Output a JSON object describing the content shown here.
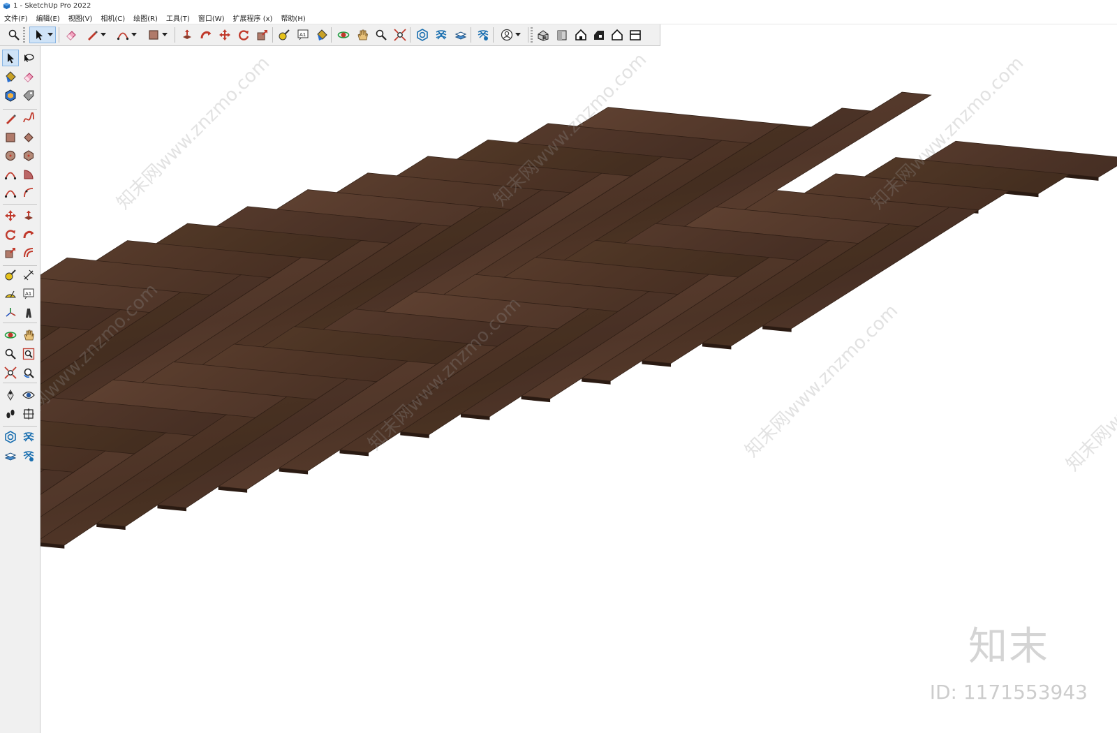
{
  "window": {
    "title": "1 - SketchUp Pro 2022"
  },
  "menu": [
    {
      "label": "文件(F)"
    },
    {
      "label": "编辑(E)"
    },
    {
      "label": "视图(V)"
    },
    {
      "label": "相机(C)"
    },
    {
      "label": "绘图(R)"
    },
    {
      "label": "工具(T)"
    },
    {
      "label": "窗口(W)"
    },
    {
      "label": "扩展程序 (x)"
    },
    {
      "label": "帮助(H)"
    }
  ],
  "top_toolbar": [
    {
      "icon": "zoom-icon",
      "active": false
    },
    {
      "icon": "select-arrow-icon",
      "active": true,
      "dropdown": true
    },
    {
      "icon": "eraser-icon"
    },
    {
      "icon": "pencil-line-icon",
      "dropdown": true
    },
    {
      "icon": "arc-icon",
      "dropdown": true
    },
    {
      "icon": "rectangle-icon",
      "dropdown": true
    },
    {
      "icon": "push-pull-icon"
    },
    {
      "icon": "follow-me-icon"
    },
    {
      "icon": "move-icon"
    },
    {
      "icon": "rotate-icon"
    },
    {
      "icon": "scale-icon"
    },
    {
      "icon": "tape-measure-icon"
    },
    {
      "icon": "text-label-icon",
      "text": "A1"
    },
    {
      "icon": "paint-bucket-icon"
    },
    {
      "icon": "orbit-icon"
    },
    {
      "icon": "pan-hand-icon"
    },
    {
      "icon": "zoom-icon"
    },
    {
      "icon": "zoom-extents-icon"
    },
    {
      "icon": "3d-warehouse-icon"
    },
    {
      "icon": "extension-warehouse-icon"
    },
    {
      "icon": "layout-icon"
    },
    {
      "icon": "extension-manager-icon"
    },
    {
      "icon": "user-account-icon",
      "dropdown": true
    },
    {
      "icon": "iso-view-icon"
    },
    {
      "icon": "top-view-icon"
    },
    {
      "icon": "front-view-icon"
    },
    {
      "icon": "right-view-icon"
    },
    {
      "icon": "back-view-icon"
    },
    {
      "icon": "left-view-icon"
    }
  ],
  "left_toolbar": [
    {
      "icon": "select-arrow-icon",
      "active": true
    },
    {
      "icon": "lasso-select-icon"
    },
    {
      "icon": "paint-bucket-icon"
    },
    {
      "icon": "eraser-icon"
    },
    {
      "icon": "make-component-icon"
    },
    {
      "icon": "tag-tool-icon"
    },
    {
      "icon": "line-icon"
    },
    {
      "icon": "freehand-icon"
    },
    {
      "icon": "rectangle-icon"
    },
    {
      "icon": "rotated-rectangle-icon"
    },
    {
      "icon": "circle-icon"
    },
    {
      "icon": "polygon-icon"
    },
    {
      "icon": "arc-icon"
    },
    {
      "icon": "pie-icon"
    },
    {
      "icon": "two-point-arc-icon"
    },
    {
      "icon": "three-point-arc-icon"
    },
    {
      "icon": "move-icon"
    },
    {
      "icon": "push-pull-icon"
    },
    {
      "icon": "rotate-icon"
    },
    {
      "icon": "follow-me-icon"
    },
    {
      "icon": "scale-icon"
    },
    {
      "icon": "offset-icon"
    },
    {
      "icon": "tape-measure-icon"
    },
    {
      "icon": "dimension-icon"
    },
    {
      "icon": "protractor-icon"
    },
    {
      "icon": "text-label-icon",
      "text": "A1"
    },
    {
      "icon": "axes-icon"
    },
    {
      "icon": "3d-text-icon"
    },
    {
      "icon": "orbit-icon"
    },
    {
      "icon": "pan-hand-icon"
    },
    {
      "icon": "zoom-icon"
    },
    {
      "icon": "zoom-window-icon"
    },
    {
      "icon": "zoom-extents-icon"
    },
    {
      "icon": "previous-view-icon"
    },
    {
      "icon": "position-camera-icon"
    },
    {
      "icon": "look-around-icon"
    },
    {
      "icon": "walk-icon"
    },
    {
      "icon": "section-plane-icon"
    },
    {
      "icon": "3d-warehouse-icon"
    },
    {
      "icon": "extension-warehouse-icon"
    },
    {
      "icon": "layout-icon"
    },
    {
      "icon": "extension-manager-icon"
    }
  ],
  "watermark": {
    "brand": "知末",
    "id_text": "ID: 1171553943",
    "repeat_text": "知末网www.znzmo.com"
  },
  "colors": {
    "wood_dark": "#3f2a20",
    "wood_mid": "#54392b",
    "wood_light": "#6a4a38",
    "toolbar_bg": "#f0f0f0",
    "active_tool": "#cfe3f7"
  },
  "model": {
    "pattern": "herringbone wood floor"
  }
}
